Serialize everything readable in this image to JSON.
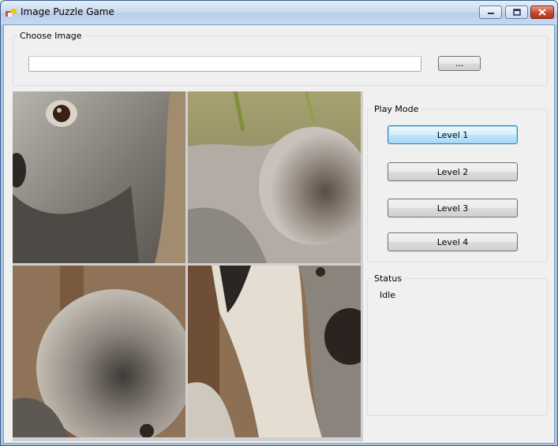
{
  "window": {
    "title": "Image Puzzle Game"
  },
  "choose_image": {
    "legend": "Choose Image",
    "path_value": "",
    "browse_label": "..."
  },
  "play_mode": {
    "legend": "Play Mode",
    "levels": [
      {
        "label": "Level 1"
      },
      {
        "label": "Level 2"
      },
      {
        "label": "Level 3"
      },
      {
        "label": "Level 4"
      }
    ]
  },
  "status": {
    "legend": "Status",
    "text": "Idle"
  },
  "puzzle": {
    "tiles": [
      {
        "subject": "koala eye and face"
      },
      {
        "subject": "koala fluffy ear"
      },
      {
        "subject": "koala ear tuft"
      },
      {
        "subject": "koala nose and paw"
      }
    ]
  }
}
